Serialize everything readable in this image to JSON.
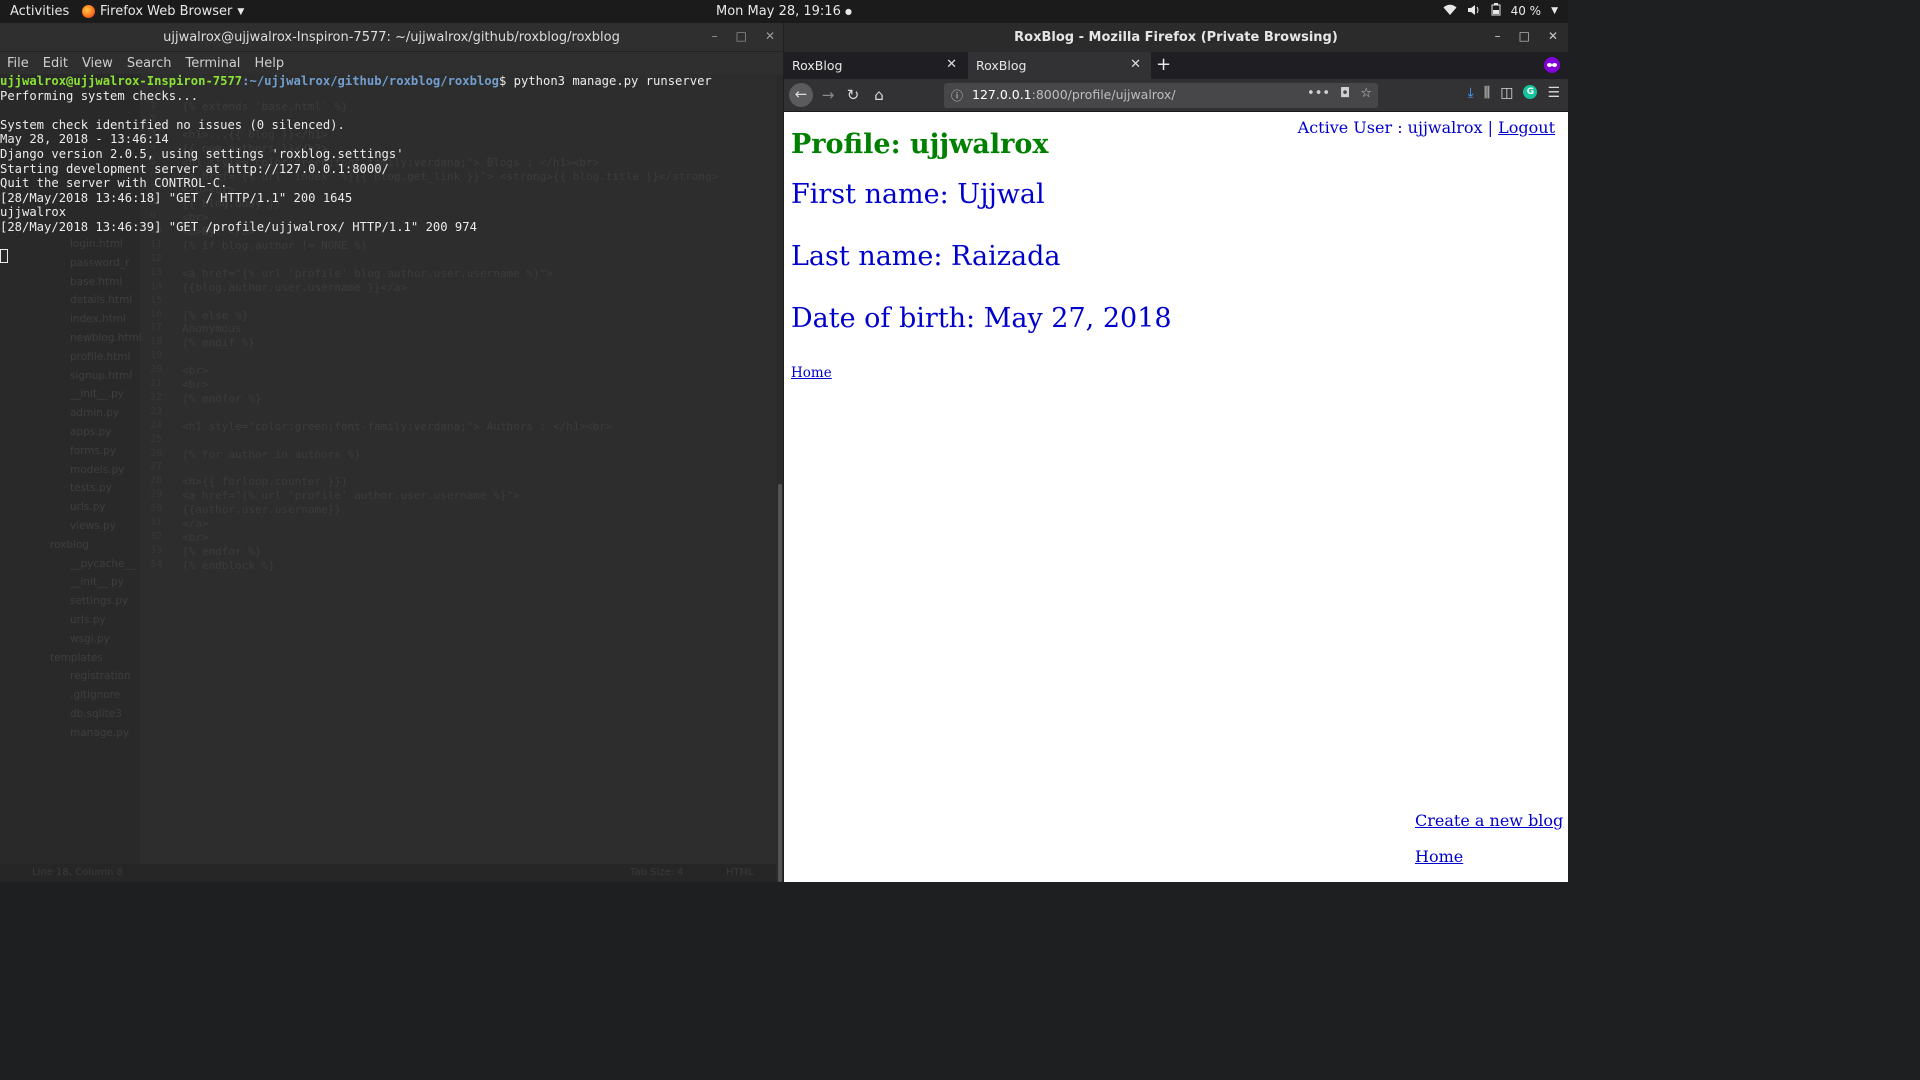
{
  "topbar": {
    "activities": "Activities",
    "app_name": "Firefox Web Browser",
    "clock": "Mon May 28, 19:16",
    "battery": "40 %"
  },
  "terminal": {
    "title": "ujjwalrox@ujjwalrox-Inspiron-7577: ~/ujjwalrox/github/roxblog/roxblog",
    "menu": [
      "File",
      "Edit",
      "View",
      "Search",
      "Terminal",
      "Help"
    ],
    "prompt_user": "ujjwalrox@ujjwalrox-Inspiron-7577",
    "prompt_path": ":~/ujjwalrox/github/roxblog/roxblog",
    "command": "$ python3 manage.py runserver",
    "output": [
      "Performing system checks...",
      "",
      "System check identified no issues (0 silenced).",
      "May 28, 2018 - 13:46:14",
      "Django version 2.0.5, using settings 'roxblog.settings'",
      "Starting development server at http://127.0.0.1:8000/",
      "Quit the server with CONTROL-C.",
      "[28/May/2018 13:46:18] \"GET / HTTP/1.1\" 200 1645",
      "ujjwalrox",
      "[28/May/2018 13:46:39] \"GET /profile/ujjwalrox/ HTTP/1.1\" 200 974"
    ]
  },
  "ghost_editor": {
    "files": [
      "login.html",
      "password_r",
      "base.html",
      "details.html",
      "index.html",
      "newblog.html",
      "profile.html",
      "signup.html",
      "__init__.py",
      "admin.py",
      "apps.py",
      "forms.py",
      "models.py",
      "tests.py",
      "urls.py",
      "views.py",
      "roxblog",
      "__pycache__",
      "__init__.py",
      "settings.py",
      "urls.py",
      "wsgi.py",
      "templates",
      "registration",
      ".gitignore",
      "db.sqlite3",
      "manage.py"
    ],
    "code": [
      "{% extends 'base.html' %}",
      "",
      "<h1>...{{ blog }}</h1>",
      "{{ num_authors }}</h2>",
      "<h1 style=\"color:green;font-family:verdana;\"> Blogs : </h1><br>",
      "<a href=\"{% url 'index' %}{{ blog.get_link }}\"> <strong>{{ blog.title }}</strong>",
      "</p><br>",
      "{{ blog.body }}",
      "<br>",
      "<b>By: </b>",
      "{% if blog.author != NONE %}",
      "",
      "<a href=\"{% url 'profile' blog.author.user.username %}\">",
      "{{blog.author.user.username }}</a>",
      "",
      "{% else %}",
      "Anonymous",
      "{% endif %}",
      "",
      "<br>",
      "<br>",
      "{% endfor %}",
      "",
      "<h1 style=\"color:green;font-family:verdana;\"> Authors : </h1><br>",
      "",
      "{% for author in authors %}",
      "",
      "<h>{{  forloop.counter  }})",
      "<a href=\"{% url 'profile' author.user.username %}\">",
      "{{author.user.username}}",
      "</a>",
      "<br>",
      "{% endfor %}",
      "{% endblock %}"
    ],
    "status_left": "Line 18, Column 8",
    "status_mid": "Tab Size: 4",
    "status_right": "HTML"
  },
  "firefox": {
    "window_title": "RoxBlog - Mozilla Firefox (Private Browsing)",
    "tabs": [
      {
        "label": "RoxBlog",
        "active": false
      },
      {
        "label": "RoxBlog",
        "active": true
      }
    ],
    "url_host": "127.0.0.1",
    "url_rest": ":8000/profile/ujjwalrox/"
  },
  "page": {
    "active_user_text": "Active User : ujjwalrox | ",
    "logout": "Logout",
    "heading": "Profile: ujjwalrox",
    "first_name": "First name: Ujjwal",
    "last_name": "Last name: Raizada",
    "dob": "Date of birth: May 27, 2018",
    "home_link": "Home",
    "create_blog": "Create a new blog",
    "home_link_bottom": "Home"
  },
  "colors": {
    "heading_green": "#008000",
    "text_blue": "#0000cc",
    "prompt_green": "#8ae234",
    "prompt_blue": "#729fcf",
    "private_purple": "#8000d7"
  }
}
